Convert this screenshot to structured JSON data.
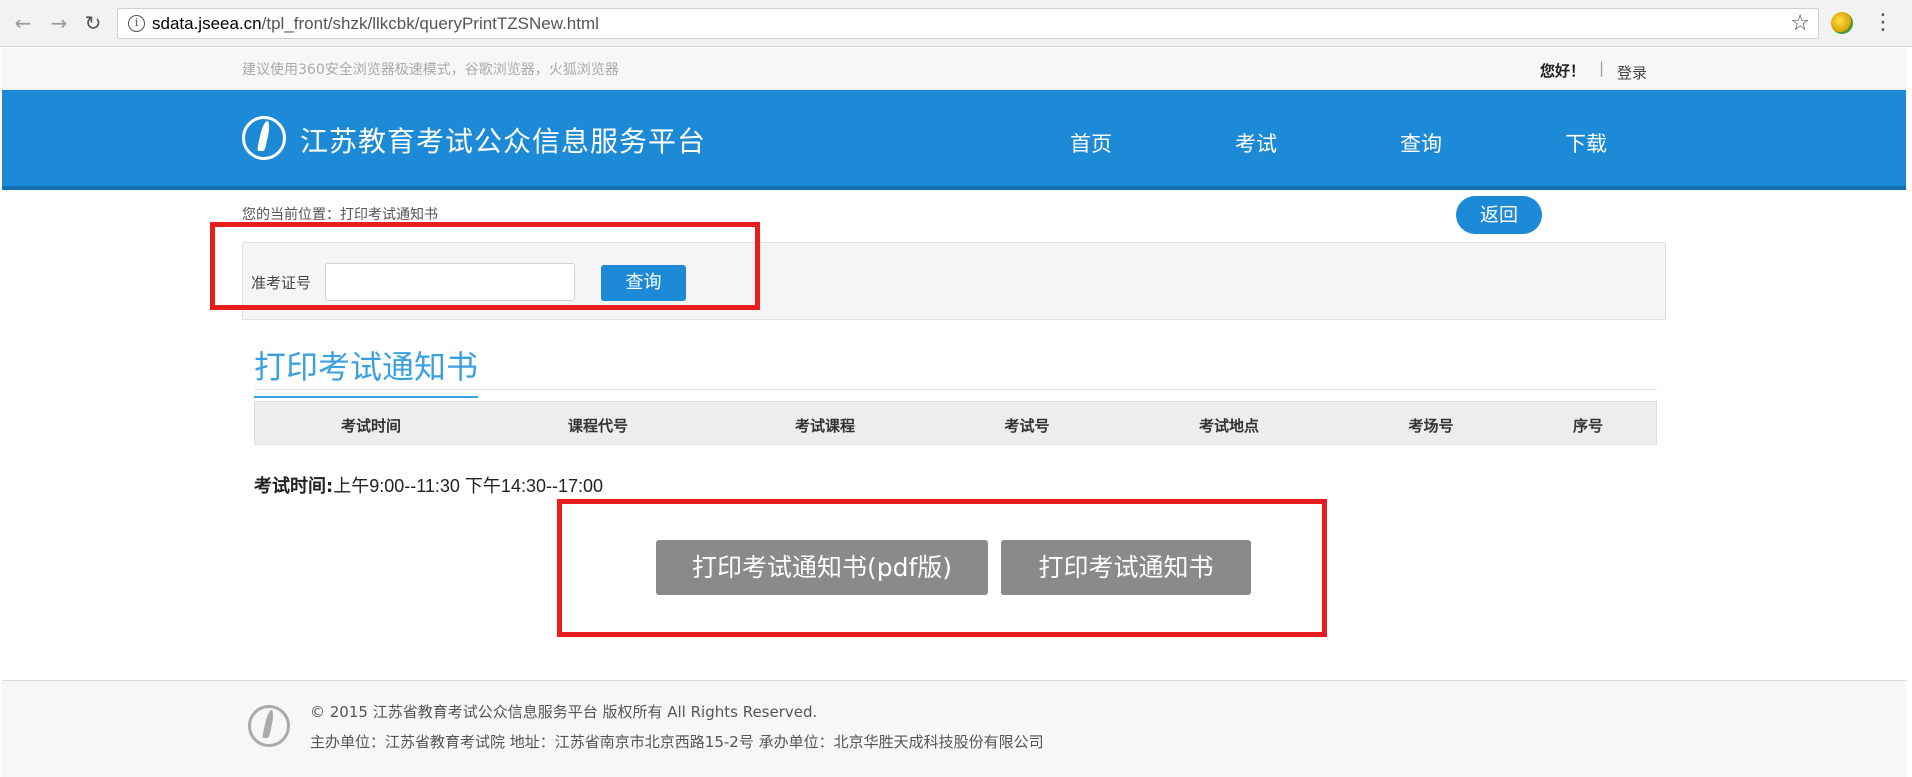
{
  "browser": {
    "back_icon": "arrow-left",
    "forward_icon": "arrow-right",
    "reload_icon": "reload",
    "info_icon": "i",
    "url_host": "sdata.jseea.cn",
    "url_path": "/tpl_front/shzk/llkcbk/queryPrintTZSNew.html",
    "star_icon": "☆",
    "menu_icon": "⋮"
  },
  "topbar": {
    "tip": "建议使用360安全浏览器极速模式，谷歌浏览器，火狐浏览器",
    "greeting": "您好！",
    "separator": "|",
    "login": "登录"
  },
  "header": {
    "site_title": "江苏教育考试公众信息服务平台",
    "nav": [
      "首页",
      "考试",
      "查询",
      "下载"
    ]
  },
  "breadcrumb": "您的当前位置：打印考试通知书",
  "back_button": "返回",
  "search": {
    "label": "准考证号",
    "value": "",
    "button": "查询"
  },
  "section_title": "打印考试通知书",
  "table": {
    "headers": [
      "考试时间",
      "课程代号",
      "考试课程",
      "考试号",
      "考试地点",
      "考场号",
      "序号"
    ]
  },
  "exam_time": {
    "label": "考试时间:",
    "value": "上午9:00--11:30 下午14:30--17:00"
  },
  "print_buttons": {
    "pdf": "打印考试通知书(pdf版)",
    "normal": "打印考试通知书"
  },
  "footer": {
    "copyright": "© 2015 江苏省教育考试公众信息服务平台 版权所有 All Rights Reserved.",
    "host_info": "主办单位：江苏省教育考试院 地址：江苏省南京市北京西路15-2号 承办单位：北京华胜天成科技股份有限公司"
  },
  "colors": {
    "brand_blue": "#1c8ad6",
    "highlight_red": "#e81e1e",
    "button_gray": "#8a8a8a"
  }
}
